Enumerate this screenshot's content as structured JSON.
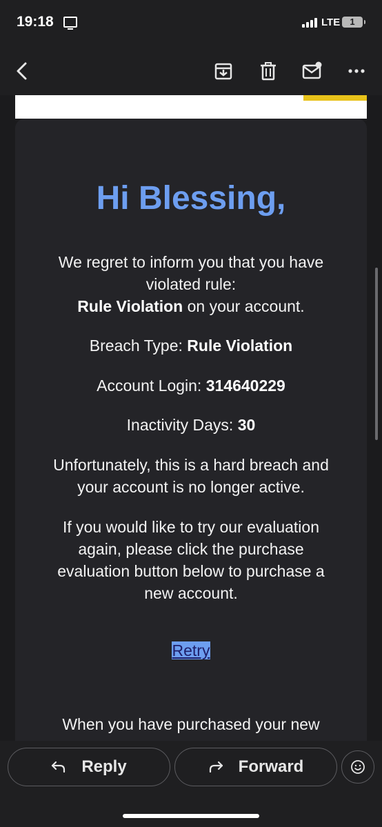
{
  "status_bar": {
    "time": "19:18",
    "network": "LTE",
    "battery": "1"
  },
  "toolbar": {
    "icons": [
      "back-icon",
      "archive-icon",
      "trash-icon",
      "mark-unread-icon",
      "more-icon"
    ]
  },
  "email": {
    "greeting": "Hi Blessing,",
    "p1_line1": "We regret to inform you that you have",
    "p1_line2": "violated rule:",
    "p1_bold": "Rule Violation",
    "p1_rest": " on your account.",
    "breach_label": "Breach Type: ",
    "breach_value": "Rule Violation",
    "login_label": "Account Login: ",
    "login_value": "314640229",
    "inactivity_label": "Inactivity Days: ",
    "inactivity_value": "30",
    "p_unfortunately_1": "Unfortunately, this is a hard breach and",
    "p_unfortunately_2": "your account is no longer active.",
    "p_retry_1": "If you would like to try our evaluation",
    "p_retry_2": "again, please click the purchase",
    "p_retry_3": "evaluation button below to purchase a",
    "p_retry_4": "new account.",
    "retry_link": "Retry",
    "p_last": "When you have purchased your new"
  },
  "actions": {
    "reply": "Reply",
    "forward": "Forward"
  },
  "colors": {
    "accent": "#6d9ef0",
    "card_bg": "#242428",
    "page_bg": "#1b1b1d"
  }
}
